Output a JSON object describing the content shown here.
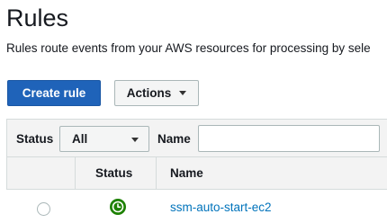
{
  "page": {
    "title": "Rules",
    "description": "Rules route events from your AWS resources for processing by sele"
  },
  "toolbar": {
    "create_label": "Create rule",
    "actions_label": "Actions"
  },
  "filter": {
    "status_label": "Status",
    "status_value": "All",
    "name_label": "Name",
    "name_value": "",
    "name_placeholder": ""
  },
  "table": {
    "columns": [
      "",
      "Status",
      "Name"
    ],
    "rows": [
      {
        "selected": false,
        "status_icon": "clock-icon",
        "status_color": "#1d8102",
        "name": "ssm-auto-start-ec2"
      }
    ]
  },
  "colors": {
    "primary": "#1f63b9",
    "link": "#0073bb",
    "status_ok": "#1d8102"
  }
}
